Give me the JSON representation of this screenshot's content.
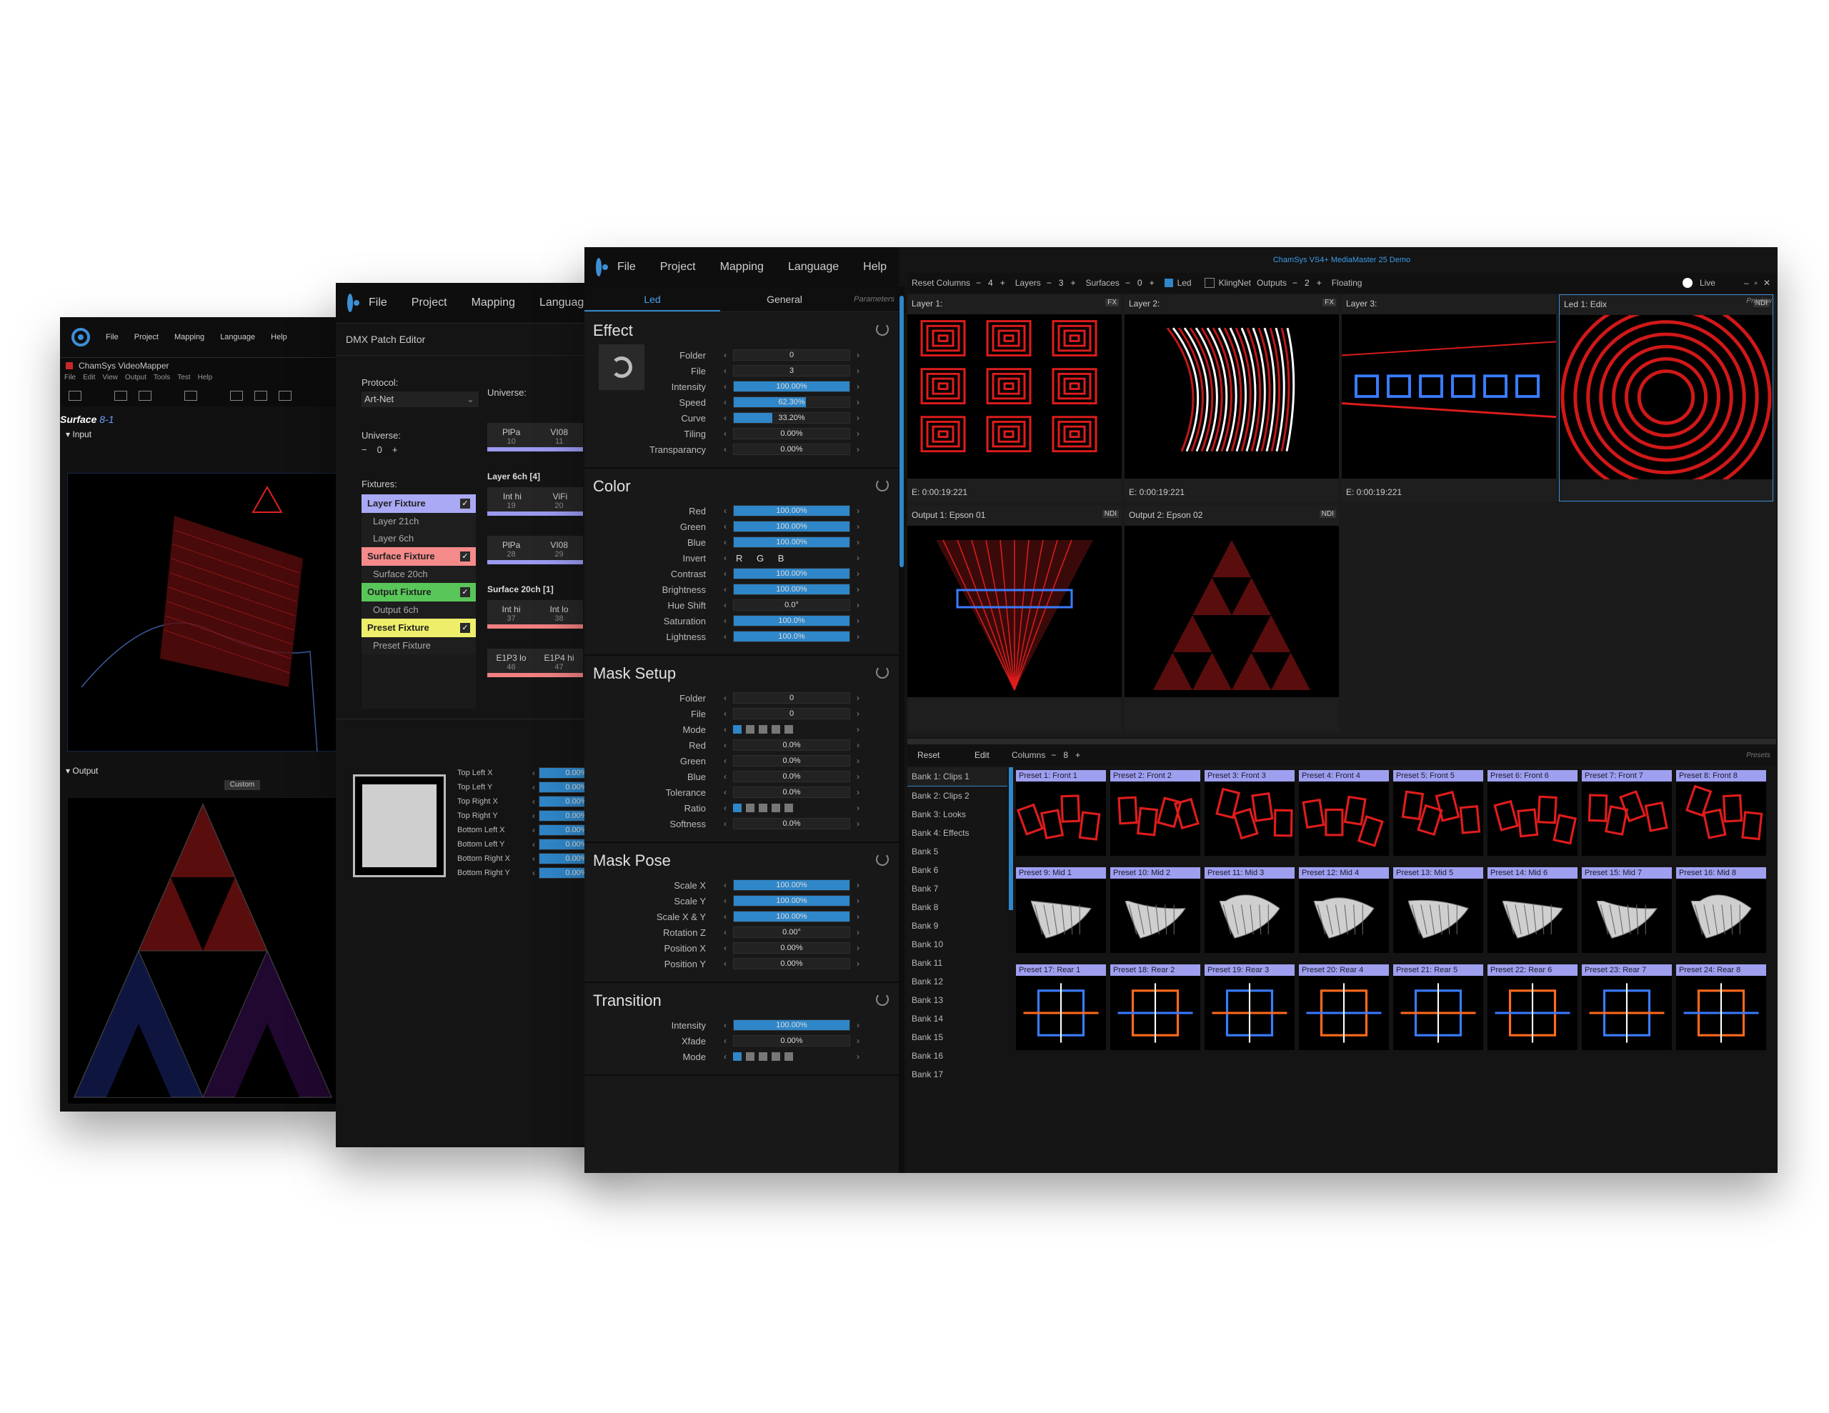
{
  "back_window": {
    "menu": [
      "File",
      "Project",
      "Mapping",
      "Language",
      "Help"
    ],
    "app_title": "ChamSys VideoMapper",
    "submenu": [
      "File",
      "Edit",
      "View",
      "Output",
      "Tools",
      "Test",
      "Help"
    ],
    "surface_label": "Surface",
    "surface_id": "8-1",
    "input_label": "Input",
    "output_label": "Output",
    "output_select": "Custom"
  },
  "dmx_window": {
    "menu": [
      "File",
      "Project",
      "Mapping",
      "Language",
      "Help"
    ],
    "panel_title": "DMX Patch Editor",
    "protocol_label": "Protocol:",
    "protocol_value": "Art-Net",
    "universe_label": "Universe:",
    "universe_value": "0",
    "universe_header": "Universe:",
    "fixtures_label": "Fixtures:",
    "fixtures": [
      {
        "label": "Layer Fixture",
        "color": "#a9a9f5",
        "subs": [
          "Layer 21ch",
          "Layer 6ch"
        ]
      },
      {
        "label": "Surface Fixture",
        "color": "#f58a8a",
        "subs": [
          "Surface 20ch"
        ]
      },
      {
        "label": "Output Fixture",
        "color": "#58c658",
        "subs": [
          "Output 6ch"
        ]
      },
      {
        "label": "Preset Fixture",
        "color": "#eeee6a",
        "subs": [
          "Preset Fixture"
        ]
      }
    ],
    "channel_groups": [
      {
        "header": "",
        "cells": [
          {
            "a": "PlPa",
            "b": "VI08",
            "na": "10",
            "nb": "11"
          }
        ],
        "stripe": "#9a9af0"
      },
      {
        "header": "Layer 6ch [4]",
        "cells": [
          {
            "a": "Int hi",
            "b": "ViFi",
            "na": "19",
            "nb": "20"
          }
        ],
        "stripe": "#9a9af0"
      },
      {
        "header": "",
        "cells": [
          {
            "a": "PlPa",
            "b": "VI08",
            "na": "28",
            "nb": "29"
          }
        ],
        "stripe": "#9a9af0"
      },
      {
        "header": "Surface 20ch [1]",
        "cells": [
          {
            "a": "Int hi",
            "b": "Int lo",
            "na": "37",
            "nb": "38"
          }
        ],
        "stripe": "#f08080"
      },
      {
        "header": "",
        "cells": [
          {
            "a": "E1P3 lo",
            "b": "E1P4 hi",
            "na": "46",
            "nb": "47"
          }
        ],
        "stripe": "#f08080"
      }
    ],
    "corners": [
      {
        "label": "Top Left X",
        "value": "0.00%"
      },
      {
        "label": "Top Left Y",
        "value": "0.00%"
      },
      {
        "label": "Top Right X",
        "value": "0.00%"
      },
      {
        "label": "Top Right Y",
        "value": "0.00%"
      },
      {
        "label": "Bottom Left X",
        "value": "0.00%"
      },
      {
        "label": "Bottom Left Y",
        "value": "0.00%"
      },
      {
        "label": "Bottom Right X",
        "value": "0.00%"
      },
      {
        "label": "Bottom Right Y",
        "value": "0.00%"
      }
    ]
  },
  "main_window": {
    "menu": [
      "File",
      "Project",
      "Mapping",
      "Language",
      "Help"
    ],
    "tabs": [
      "Led",
      "General"
    ],
    "parameters_label": "Parameters",
    "sections": [
      {
        "title": "Effect",
        "params": [
          {
            "label": "Folder",
            "value": "0",
            "fill": 0
          },
          {
            "label": "File",
            "value": "3",
            "fill": 0
          },
          {
            "label": "Intensity",
            "value": "100.00%",
            "fill": 100
          },
          {
            "label": "Speed",
            "value": "62.30%",
            "fill": 62.3
          },
          {
            "label": "Curve",
            "value": "33.20%",
            "fill": 33.2
          },
          {
            "label": "Tiling",
            "value": "0.00%",
            "fill": 0
          },
          {
            "label": "Transparancy",
            "value": "0.00%",
            "fill": 0
          }
        ]
      },
      {
        "title": "Color",
        "params": [
          {
            "label": "Red",
            "value": "100.00%",
            "fill": 100
          },
          {
            "label": "Green",
            "value": "100.00%",
            "fill": 100
          },
          {
            "label": "Blue",
            "value": "100.00%",
            "fill": 100
          },
          {
            "label": "Invert",
            "value": "R   G   B",
            "fill": -1
          },
          {
            "label": "Contrast",
            "value": "100.00%",
            "fill": 100
          },
          {
            "label": "Brightness",
            "value": "100.00%",
            "fill": 100
          },
          {
            "label": "Hue Shift",
            "value": "0.0°",
            "fill": 0
          },
          {
            "label": "Saturation",
            "value": "100.0%",
            "fill": 100
          },
          {
            "label": "Lightness",
            "value": "100.0%",
            "fill": 100
          }
        ]
      },
      {
        "title": "Mask Setup",
        "params": [
          {
            "label": "Folder",
            "value": "0",
            "fill": 0
          },
          {
            "label": "File",
            "value": "0",
            "fill": 0
          },
          {
            "label": "Mode",
            "value": "",
            "fill": -1
          },
          {
            "label": "Red",
            "value": "0.0%",
            "fill": 0
          },
          {
            "label": "Green",
            "value": "0.0%",
            "fill": 0
          },
          {
            "label": "Blue",
            "value": "0.0%",
            "fill": 0
          },
          {
            "label": "Tolerance",
            "value": "0.0%",
            "fill": 0
          },
          {
            "label": "Ratio",
            "value": "",
            "fill": -1
          },
          {
            "label": "Softness",
            "value": "0.0%",
            "fill": 0
          }
        ]
      },
      {
        "title": "Mask Pose",
        "params": [
          {
            "label": "Scale X",
            "value": "100.00%",
            "fill": 100
          },
          {
            "label": "Scale Y",
            "value": "100.00%",
            "fill": 100
          },
          {
            "label": "Scale X & Y",
            "value": "100.00%",
            "fill": 100
          },
          {
            "label": "Rotation Z",
            "value": "0.00°",
            "fill": 0
          },
          {
            "label": "Position X",
            "value": "0.00%",
            "fill": 0
          },
          {
            "label": "Position Y",
            "value": "0.00%",
            "fill": 0
          }
        ]
      },
      {
        "title": "Transition",
        "params": [
          {
            "label": "Intensity",
            "value": "100.00%",
            "fill": 100
          },
          {
            "label": "Xfade",
            "value": "0.00%",
            "fill": 0
          },
          {
            "label": "Mode",
            "value": "",
            "fill": -1
          }
        ]
      }
    ],
    "title_text": "ChamSys VS4+ MediaMaster 25 Demo",
    "toolbar": {
      "reset_columns": "Reset Columns",
      "columns_value": "4",
      "layers_label": "Layers",
      "layers_value": "3",
      "surfaces_label": "Surfaces",
      "surfaces_value": "0",
      "led_label": "Led",
      "klingnet_label": "KlingNet",
      "outputs_label": "Outputs",
      "outputs_value": "2",
      "floating_label": "Floating",
      "live_label": "Live"
    },
    "layers": [
      {
        "title": "Layer 1:",
        "time": "E: 0:00:19:221",
        "badge": "FX"
      },
      {
        "title": "Layer 2:",
        "time": "E: 0:00:19:221",
        "badge": "FX"
      },
      {
        "title": "Layer 3:",
        "time": "E: 0:00:19:221",
        "badge": ""
      },
      {
        "title": "Led 1: Edix",
        "time": "",
        "badge": "NDI"
      }
    ],
    "preview_label": "Preview",
    "outputs": [
      {
        "title": "Output 1: Epson 01",
        "badge": "NDI"
      },
      {
        "title": "Output 2: Epson 02",
        "badge": "NDI"
      }
    ],
    "presets_bar": {
      "reset": "Reset",
      "edit": "Edit",
      "columns_label": "Columns",
      "columns_value": "8",
      "presets_label": "Presets"
    },
    "banks": [
      "Bank 1: Clips 1",
      "Bank 2: Clips 2",
      "Bank 3: Looks",
      "Bank 4: Effects",
      "Bank 5",
      "Bank 6",
      "Bank 7",
      "Bank 8",
      "Bank 9",
      "Bank 10",
      "Bank 11",
      "Bank 12",
      "Bank 13",
      "Bank 14",
      "Bank 15",
      "Bank 16",
      "Bank 17"
    ],
    "presets": [
      "Preset 1: Front 1",
      "Preset 2: Front 2",
      "Preset 3: Front 3",
      "Preset 4: Front 4",
      "Preset 5: Front 5",
      "Preset 6: Front 6",
      "Preset 7: Front 7",
      "Preset 8: Front 8",
      "Preset 9: Mid 1",
      "Preset 10: Mid 2",
      "Preset 11: Mid 3",
      "Preset 12: Mid 4",
      "Preset 13: Mid 5",
      "Preset 14: Mid 6",
      "Preset 15: Mid 7",
      "Preset 16: Mid 8",
      "Preset 17: Rear 1",
      "Preset 18: Rear 2",
      "Preset 19: Rear 3",
      "Preset 20: Rear 4",
      "Preset 21: Rear 5",
      "Preset 22: Rear 6",
      "Preset 23: Rear 7",
      "Preset 24: Rear 8"
    ]
  },
  "colors": {
    "accent": "#2f86c8",
    "preset_header": "#9f9ff0",
    "red_content": "#d01818",
    "blue_content": "#3a6cff"
  }
}
